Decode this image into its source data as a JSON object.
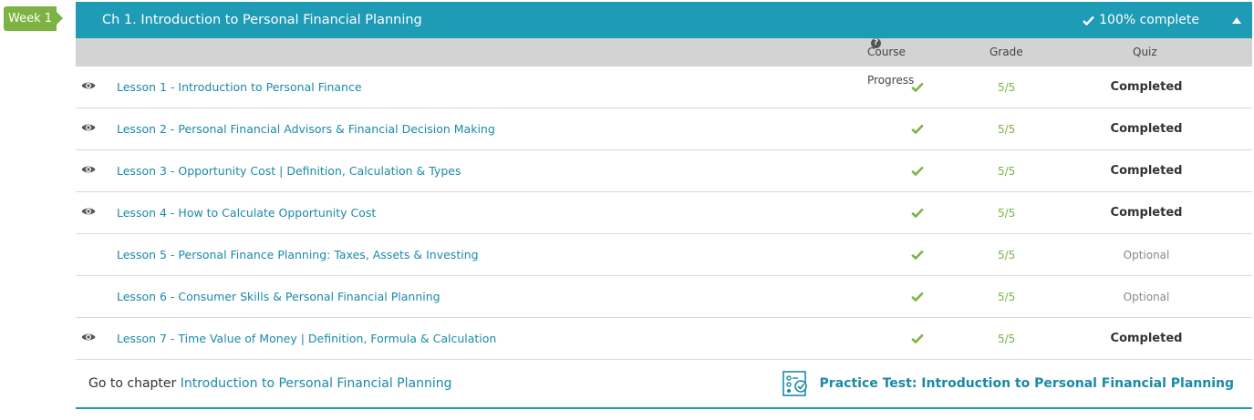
{
  "week_tag": "Week 1",
  "chapter": {
    "title": "Ch 1. Introduction to Personal Financial Planning",
    "complete_text": "100% complete",
    "colors": {
      "header_bg": "#1e9bb5",
      "accent_green": "#7cb342",
      "link": "#1a8aa8"
    }
  },
  "columns": {
    "progress": "Course Progress",
    "progress_help_icon": "?",
    "grade": "Grade",
    "quiz": "Quiz"
  },
  "lessons": [
    {
      "title": "Lesson 1 - Introduction to Personal Finance",
      "viewed": true,
      "grade": "5/5",
      "quiz": "Completed"
    },
    {
      "title": "Lesson 2 - Personal Financial Advisors & Financial Decision Making",
      "viewed": true,
      "grade": "5/5",
      "quiz": "Completed"
    },
    {
      "title": "Lesson 3 - Opportunity Cost | Definition, Calculation & Types",
      "viewed": true,
      "grade": "5/5",
      "quiz": "Completed"
    },
    {
      "title": "Lesson 4 - How to Calculate Opportunity Cost",
      "viewed": true,
      "grade": "5/5",
      "quiz": "Completed"
    },
    {
      "title": "Lesson 5 - Personal Finance Planning: Taxes, Assets & Investing",
      "viewed": false,
      "grade": "5/5",
      "quiz": "Optional"
    },
    {
      "title": "Lesson 6 - Consumer Skills & Personal Financial Planning",
      "viewed": false,
      "grade": "5/5",
      "quiz": "Optional"
    },
    {
      "title": "Lesson 7 - Time Value of Money | Definition, Formula & Calculation",
      "viewed": true,
      "grade": "5/5",
      "quiz": "Completed"
    }
  ],
  "footer": {
    "goto_prefix": "Go to chapter",
    "goto_link": "Introduction to Personal Financial Planning",
    "practice_test": "Practice Test: Introduction to Personal Financial Planning"
  }
}
